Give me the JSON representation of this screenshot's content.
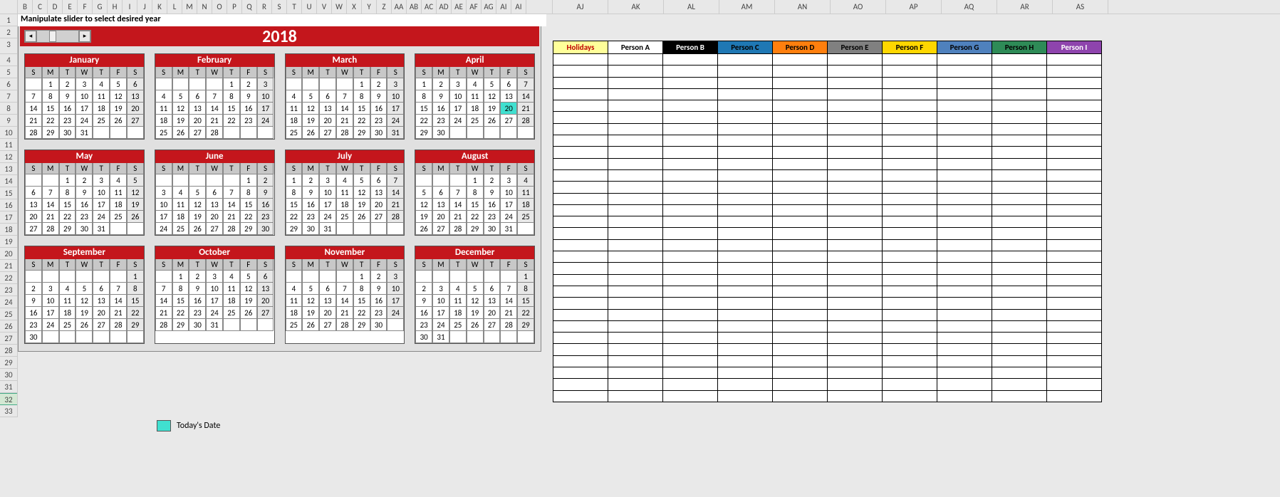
{
  "instruction": "Manipulate slider to select desired year",
  "year": "2018",
  "dow": [
    "S",
    "M",
    "T",
    "W",
    "T",
    "F",
    "S"
  ],
  "months": [
    {
      "name": "January",
      "start": 1,
      "days": 31
    },
    {
      "name": "February",
      "start": 4,
      "days": 28
    },
    {
      "name": "March",
      "start": 4,
      "days": 31
    },
    {
      "name": "April",
      "start": 0,
      "days": 30,
      "today": 20
    },
    {
      "name": "May",
      "start": 2,
      "days": 31
    },
    {
      "name": "June",
      "start": 5,
      "days": 30
    },
    {
      "name": "July",
      "start": 0,
      "days": 31
    },
    {
      "name": "August",
      "start": 3,
      "days": 31
    },
    {
      "name": "September",
      "start": 6,
      "days": 30
    },
    {
      "name": "October",
      "start": 1,
      "days": 31
    },
    {
      "name": "November",
      "start": 4,
      "days": 30
    },
    {
      "name": "December",
      "start": 6,
      "days": 31
    }
  ],
  "legend": {
    "today": "Today's Date"
  },
  "columns_narrow": [
    "B",
    "C",
    "D",
    "E",
    "F",
    "G",
    "H",
    "I",
    "J",
    "K",
    "L",
    "M",
    "N",
    "O",
    "P",
    "Q",
    "R",
    "S",
    "T",
    "U",
    "V",
    "W",
    "X",
    "Y",
    "Z",
    "AA",
    "AB",
    "AC",
    "AD",
    "AE",
    "AF",
    "AG",
    "AI",
    "AI"
  ],
  "columns_wide": [
    "AJ",
    "AK",
    "AL",
    "AM",
    "AN",
    "AO",
    "AP",
    "AQ",
    "AR",
    "AS"
  ],
  "row_numbers": [
    1,
    2,
    3,
    4,
    5,
    6,
    7,
    8,
    9,
    10,
    11,
    12,
    13,
    14,
    15,
    16,
    17,
    18,
    19,
    20,
    21,
    22,
    23,
    24,
    25,
    26,
    27,
    28,
    29,
    30,
    31,
    32,
    33
  ],
  "person_headers": [
    {
      "label": "Holidays",
      "bg": "#ffff99",
      "fg": "#c00000"
    },
    {
      "label": "Person A",
      "bg": "#ffffff",
      "fg": "#000000"
    },
    {
      "label": "Person B",
      "bg": "#000000",
      "fg": "#ffffff"
    },
    {
      "label": "Person C",
      "bg": "#1f78b4",
      "fg": "#000000"
    },
    {
      "label": "Person D",
      "bg": "#ff7f0e",
      "fg": "#000000"
    },
    {
      "label": "Person E",
      "bg": "#808080",
      "fg": "#000000"
    },
    {
      "label": "Person F",
      "bg": "#ffd700",
      "fg": "#000000"
    },
    {
      "label": "Person G",
      "bg": "#4f81bd",
      "fg": "#000000"
    },
    {
      "label": "Person H",
      "bg": "#2e8b57",
      "fg": "#000000"
    },
    {
      "label": "Person I",
      "bg": "#8e44ad",
      "fg": "#ffffff"
    }
  ],
  "person_body_rows": 30
}
